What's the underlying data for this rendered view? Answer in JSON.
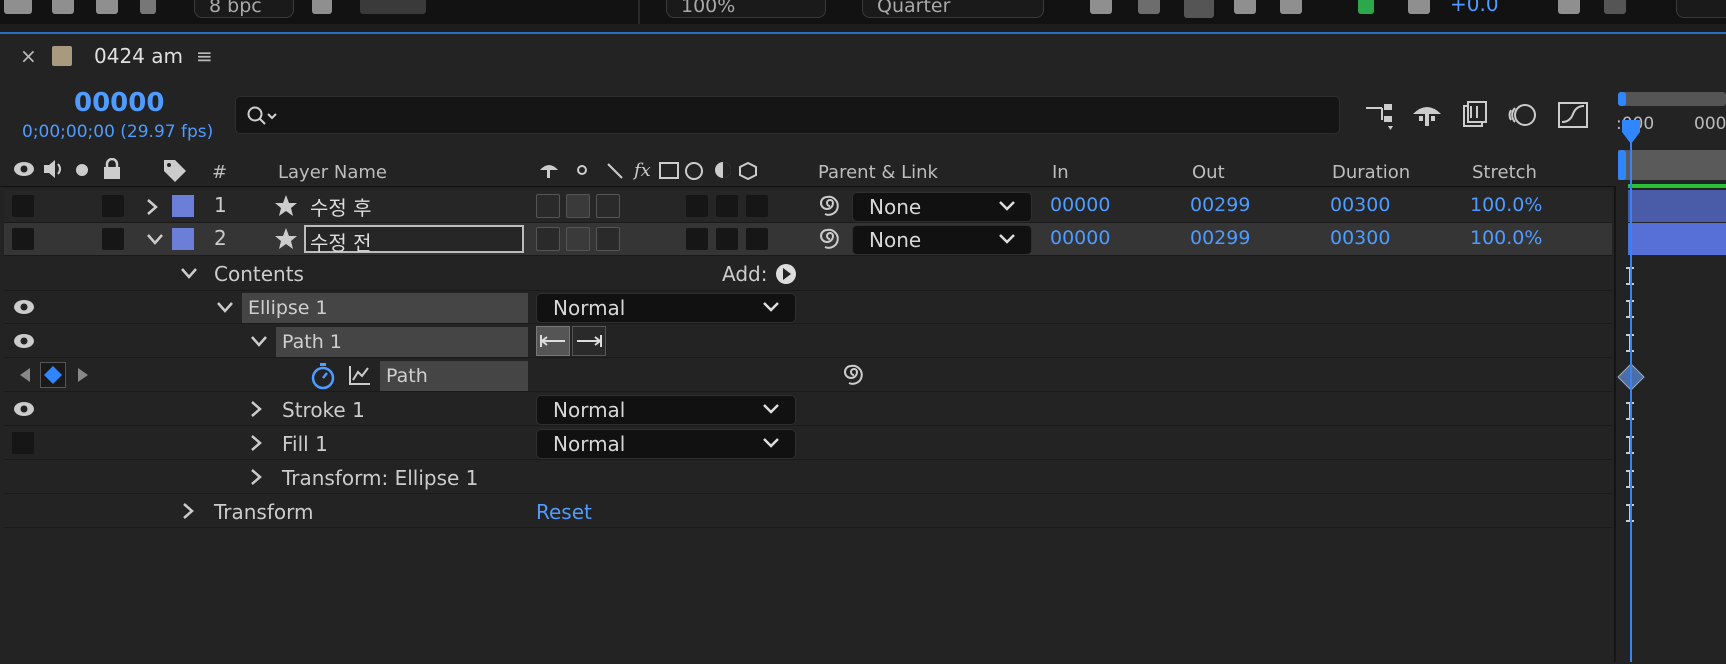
{
  "topbar": {
    "bpc": "8 bpc",
    "zoom": "100%",
    "resolution": "Quarter",
    "exposure": "+0.0"
  },
  "panel": {
    "comp_name": "0424 am",
    "timecode": "00000",
    "fps_info": "0;00;00;00 (29.97 fps)",
    "timeline_ruler": ":000",
    "timeline_ruler2": "000"
  },
  "headers": {
    "hash": "#",
    "layer_name": "Layer Name",
    "parent_link": "Parent & Link",
    "in": "In",
    "out": "Out",
    "duration": "Duration",
    "stretch": "Stretch"
  },
  "layers": [
    {
      "index": "1",
      "name": "수정 후",
      "parent": "None",
      "in": "00000",
      "out": "00299",
      "duration": "00300",
      "stretch": "100.0%"
    },
    {
      "index": "2",
      "name": "수정 전",
      "parent": "None",
      "in": "00000",
      "out": "00299",
      "duration": "00300",
      "stretch": "100.0%"
    }
  ],
  "tree": {
    "contents": "Contents",
    "add": "Add:",
    "ellipse": "Ellipse 1",
    "ellipse_mode": "Normal",
    "path_group": "Path 1",
    "path_prop": "Path",
    "stroke": "Stroke 1",
    "stroke_mode": "Normal",
    "fill": "Fill 1",
    "fill_mode": "Normal",
    "transform_ellipse": "Transform: Ellipse 1",
    "transform": "Transform",
    "reset": "Reset"
  },
  "colors": {
    "accent": "#4f9bff",
    "label": "#6b7fd8",
    "timeline_bar": "#4a5ba8",
    "green": "#27c23a"
  }
}
